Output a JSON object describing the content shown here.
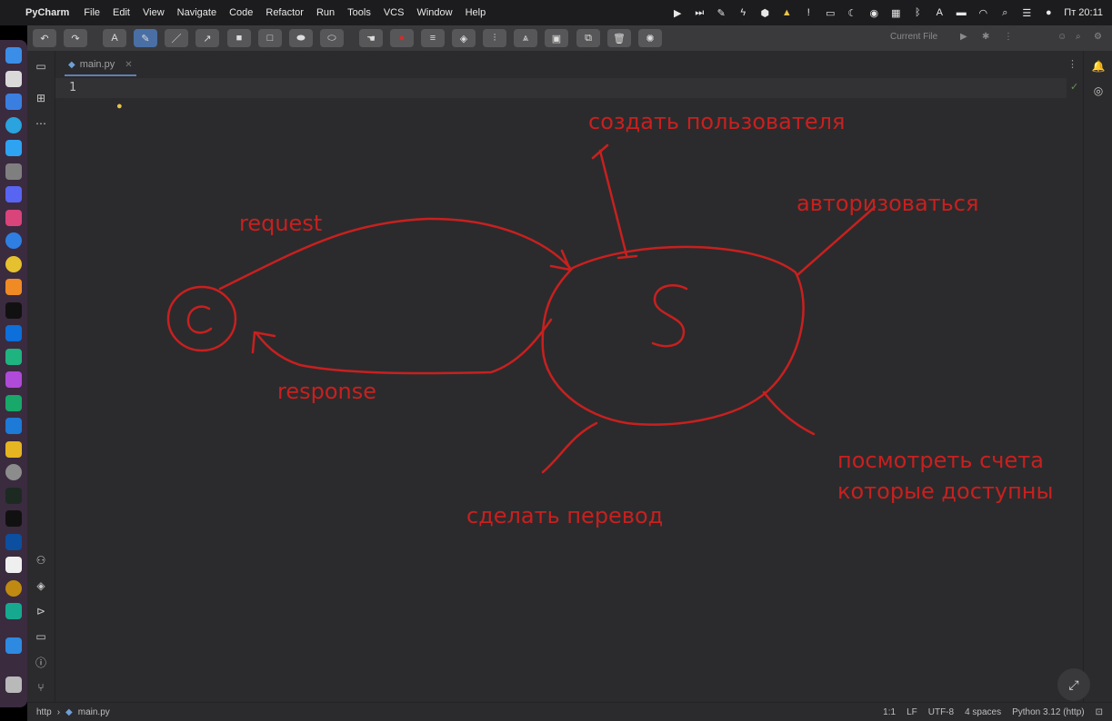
{
  "menubar": {
    "app_name": "PyCharm",
    "menus": [
      "File",
      "Edit",
      "View",
      "Navigate",
      "Code",
      "Refactor",
      "Run",
      "Tools",
      "VCS",
      "Window",
      "Help"
    ],
    "clock": "Пт 20:11"
  },
  "toolbar": {
    "run_config": "Current File"
  },
  "editor": {
    "tab_name": "main.py",
    "line_number": "1"
  },
  "statusbar": {
    "breadcrumb_project": "http",
    "breadcrumb_file": "main.py",
    "position": "1:1",
    "line_ending": "LF",
    "encoding": "UTF-8",
    "indent": "4 spaces",
    "interpreter": "Python 3.12 (http)"
  },
  "annotations": {
    "client_letter": "C",
    "server_letter": "S",
    "request": "request",
    "response": "response",
    "create_user": "создать пользователя",
    "authorize": "авторизоваться",
    "view_accounts": "посмотреть счета\nкоторые доступны",
    "make_transfer": "сделать перевод"
  },
  "colors": {
    "ink": "#c8201f",
    "editor_bg": "#2b2b2d",
    "accent": "#4a6fa5"
  }
}
